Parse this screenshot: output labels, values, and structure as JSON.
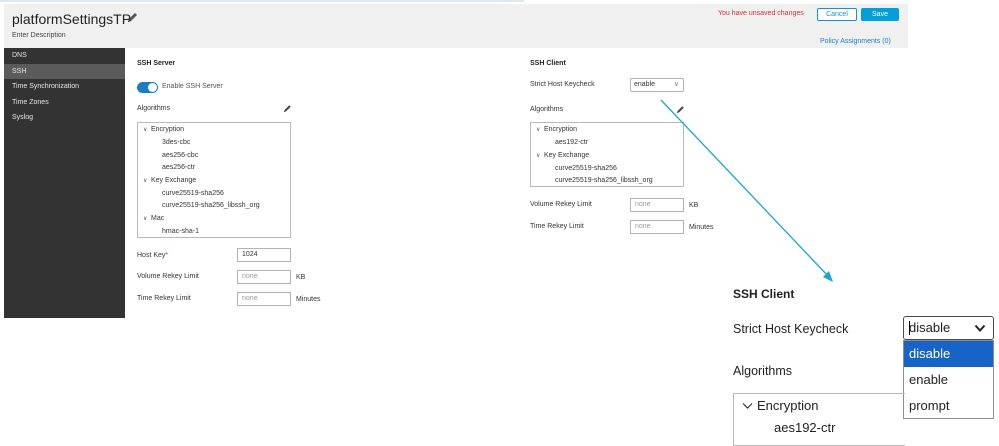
{
  "header": {
    "title": "platformSettingsTP",
    "description": "Enter Description",
    "unsaved": "You have unsaved changes",
    "cancel": "Cancel",
    "save": "Save",
    "policy_assignments": "Policy Assignments (0)"
  },
  "sidebar": {
    "items": [
      {
        "label": "DNS",
        "active": false
      },
      {
        "label": "SSH",
        "active": true
      },
      {
        "label": "Time Synchronization",
        "active": false
      },
      {
        "label": "Time Zones",
        "active": false
      },
      {
        "label": "Syslog",
        "active": false
      }
    ]
  },
  "ssh_server": {
    "title": "SSH Server",
    "enable_label": "Enable SSH Server",
    "enabled": true,
    "algorithms_label": "Algorithms",
    "tree": {
      "encryption": "Encryption",
      "enc_items": [
        "3des-cbc",
        "aes256-cbc",
        "aes256-ctr"
      ],
      "key_exchange": "Key Exchange",
      "kex_items": [
        "curve25519-sha256",
        "curve25519-sha256_libssh_org"
      ],
      "mac": "Mac",
      "mac_items": [
        "hmac-sha-1"
      ]
    },
    "host_key_label": "Host Key",
    "host_key_required": "*",
    "host_key_value": "1024",
    "volume_rekey_label": "Volume Rekey Limit",
    "volume_rekey_placeholder": "none",
    "volume_unit": "KB",
    "time_rekey_label": "Time Rekey Limit",
    "time_rekey_placeholder": "none",
    "time_unit": "Minutes"
  },
  "ssh_client": {
    "title": "SSH Client",
    "strict_label": "Strict Host Keycheck",
    "strict_value": "enable",
    "algorithms_label": "Algorithms",
    "tree": {
      "encryption": "Encryption",
      "enc_items": [
        "aes192-ctr"
      ],
      "key_exchange": "Key Exchange",
      "kex_items": [
        "curve25519-sha256",
        "curve25519-sha256_libssh_org"
      ]
    },
    "volume_rekey_label": "Volume Rekey Limit",
    "volume_rekey_placeholder": "none",
    "volume_unit": "KB",
    "time_rekey_label": "Time Rekey Limit",
    "time_rekey_placeholder": "none",
    "time_unit": "Minutes"
  },
  "zoom": {
    "title": "SSH Client",
    "strict_label": "Strict Host Keycheck",
    "selected": "disable",
    "options": [
      {
        "label": "disable",
        "highlighted": true
      },
      {
        "label": "enable",
        "highlighted": false
      },
      {
        "label": "prompt",
        "highlighted": false
      }
    ],
    "algorithms_label": "Algorithms",
    "tree_encryption": "Encryption",
    "tree_item": "aes192-ctr"
  },
  "colors": {
    "accent": "#049fd9",
    "sidebar_bg": "#333333",
    "sidebar_active": "#5b5b5b",
    "warning": "#d6302a",
    "highlight": "#1664c8",
    "callout_arrow": "#1aa3d6"
  }
}
